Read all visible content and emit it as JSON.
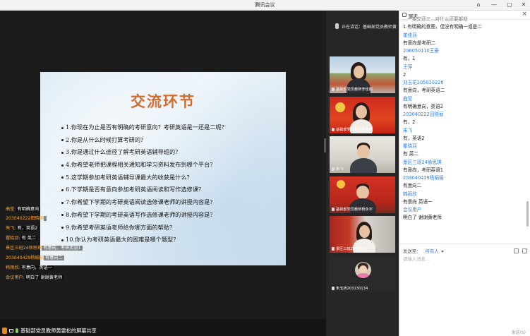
{
  "window": {
    "title": "腾讯会议",
    "controls": [
      "⌂",
      "—",
      "▢",
      "✕"
    ]
  },
  "slide": {
    "title": "交流环节",
    "items": [
      "1.你现在为止是否有明确的考研意向？考研英语是一还是二呢？",
      "2.你是从什么时候打算考研的？",
      "3.你是通过什么途径了解考研英语辅导班的？",
      "4.你希望老师把课程相关通知和学习资料发布到哪个平台？",
      "5.这学期参加考研英语辅导课最大的收获是什么？",
      "6.下学期是否有意向参加考研英语阅读和写作选修课？",
      "7.你希望下学期的考研英语阅读选修课老师的讲授内容是？",
      "8.你希望下学期的考研英语写作选修课老师的讲授内容是？",
      "9.你希望考研英语老师给你哪方面的帮助？",
      "10.你认为考研英语最大的困难是哪个题型？"
    ]
  },
  "overlay_chat": [
    {
      "name": "曲莹:",
      "msg": "有明确意向"
    },
    {
      "name": "203040222田晓丽",
      "msg": ""
    },
    {
      "name": "朱飞:",
      "msg": "有，英语2"
    },
    {
      "name": "瞿晓羽:",
      "msg": "有 英二"
    },
    {
      "name": "景区三班24徐思琪",
      "msg": "有意向，考研英语1"
    },
    {
      "name": "203040429杨娟娟",
      "msg": "有意向二"
    },
    {
      "name": "韩雨欣:",
      "msg": "有意向，英语一"
    },
    {
      "name": "会议用户:",
      "msg": "明白了  谢谢黄老师"
    }
  ],
  "share_bar": {
    "text": "基础部党员教师黄雷松的屏幕共享"
  },
  "speaking": {
    "text": "正在讲话：基础部党员教师黄雷..."
  },
  "tiles": [
    {
      "label": "基础部党员教师李佳丽"
    },
    {
      "label": "基础部党员教师郭金红"
    },
    {
      "label": "朱飞"
    },
    {
      "label": "基础部党员教师杨永宇"
    },
    {
      "label": "景区三班24徐思琪"
    },
    {
      "label": "朱玉娇203130134"
    }
  ],
  "chat": {
    "title": "聊天",
    "messages": [
      {
        "kind": "text",
        "text": "...一相交还三...对什么还要部就"
      },
      {
        "kind": "text",
        "text": "1.有明确的意图，但没有明确一或是二"
      },
      {
        "kind": "name",
        "text": "崔佳羽"
      },
      {
        "kind": "text",
        "text": "有意向是考研二"
      },
      {
        "kind": "name",
        "text": "206050110王豪"
      },
      {
        "kind": "text",
        "text": "有，1"
      },
      {
        "kind": "name",
        "text": "王萍"
      },
      {
        "kind": "text",
        "text": "2"
      },
      {
        "kind": "name",
        "text": "刘玉花205010226"
      },
      {
        "kind": "text",
        "text": "有意向，考研英语二"
      },
      {
        "kind": "name",
        "text": "曲莹"
      },
      {
        "kind": "text",
        "text": "有明确意向，英语2"
      },
      {
        "kind": "name",
        "text": "203040222田晓丽"
      },
      {
        "kind": "text",
        "text": "有，2"
      },
      {
        "kind": "name",
        "text": "朱飞"
      },
      {
        "kind": "text",
        "text": "有，英语2"
      },
      {
        "kind": "name",
        "text": "瞿晓羽"
      },
      {
        "kind": "text",
        "text": "有 英二"
      },
      {
        "kind": "name",
        "text": "景区三班24徐思琪"
      },
      {
        "kind": "text",
        "text": "有意向，考研英语1"
      },
      {
        "kind": "name",
        "text": "203040429杨娟娟"
      },
      {
        "kind": "text",
        "text": "有意向二"
      },
      {
        "kind": "name",
        "text": "韩雨欣"
      },
      {
        "kind": "text",
        "text": "有意向  英语一"
      },
      {
        "kind": "name",
        "text": "会议用户"
      },
      {
        "kind": "text",
        "text": "明白了  谢谢黄老师"
      }
    ],
    "send_to_label": "发送至：",
    "send_to_value": "所有人",
    "input_placeholder": "请输入消息...",
    "send_button": "发送(S)"
  },
  "colors": {
    "accent_orange": "#d36b2a",
    "chat_name_blue": "#2f7de0",
    "overlay_name": "#f3a33a"
  }
}
